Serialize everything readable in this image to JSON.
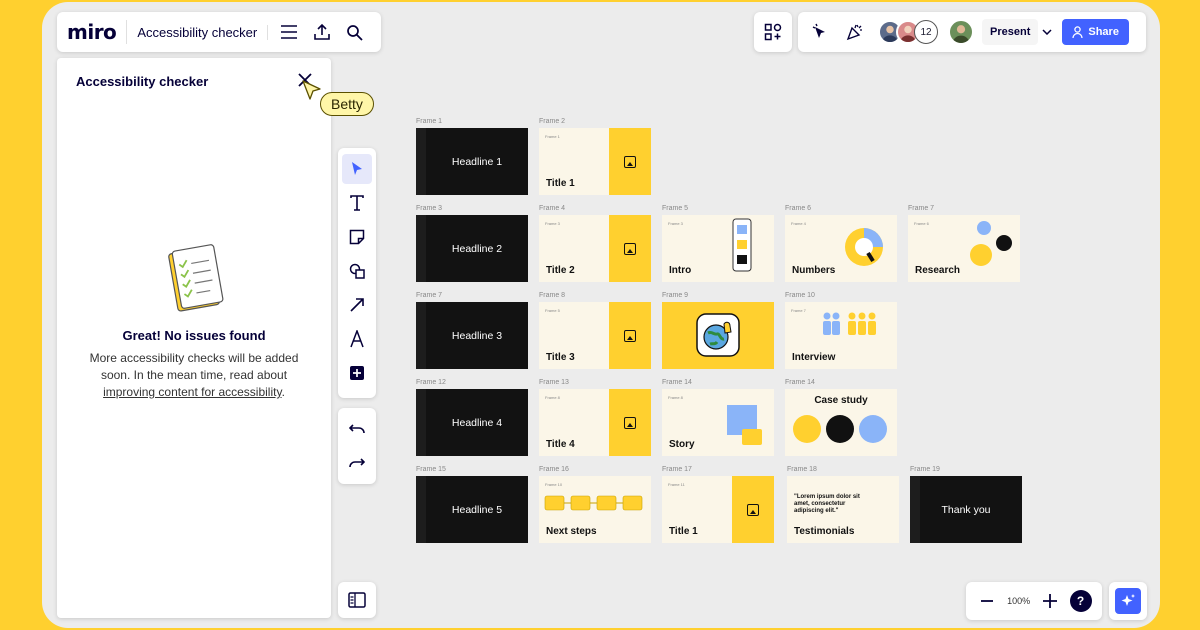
{
  "topbar": {
    "logo": "miro",
    "board_title": "Accessibility checker"
  },
  "side_panel": {
    "title": "Accessibility checker",
    "status_title": "Great! No issues found",
    "message": "More accessibility checks will be added soon. In the mean time, read about",
    "link_text": "improving content for accessibility",
    "period": "."
  },
  "cursor": {
    "name": "Betty"
  },
  "collab": {
    "collaborator_count": "12",
    "present_label": "Present",
    "share_label": "Share",
    "colors": {
      "accent": "#4262ff",
      "brand_yellow": "#FFD02F"
    }
  },
  "zoom": {
    "value": "100%"
  },
  "help": {
    "label": "?"
  },
  "frames": [
    {
      "label": "Frame 1",
      "style": "dark",
      "text": "Headline 1"
    },
    {
      "label": "Frame 2",
      "style": "title",
      "text": "Title 1",
      "mini": "Frame 1"
    },
    {
      "label": "Frame 3",
      "style": "dark",
      "text": "Headline 2"
    },
    {
      "label": "Frame 4",
      "style": "title",
      "text": "Title 2",
      "mini": "Frame 3"
    },
    {
      "label": "Frame 5",
      "style": "intro",
      "text": "Intro",
      "mini": "Frame 3"
    },
    {
      "label": "Frame 6",
      "style": "numbers",
      "text": "Numbers",
      "mini": "Frame 4"
    },
    {
      "label": "Frame 7",
      "style": "research",
      "text": "Research",
      "mini": "Frame 6"
    },
    {
      "label": "Frame 7",
      "style": "dark",
      "text": "Headline 3"
    },
    {
      "label": "Frame 8",
      "style": "title",
      "text": "Title 3",
      "mini": "Frame 5"
    },
    {
      "label": "Frame 9",
      "style": "emoji",
      "text": ""
    },
    {
      "label": "Frame 10",
      "style": "interview",
      "text": "Interview",
      "mini": "Frame 7"
    },
    {
      "label": "Frame 12",
      "style": "dark",
      "text": "Headline 4"
    },
    {
      "label": "Frame 13",
      "style": "title",
      "text": "Title 4",
      "mini": "Frame 8"
    },
    {
      "label": "Frame 14",
      "style": "story",
      "text": "Story",
      "mini": "Frame 8"
    },
    {
      "label": "Frame 14",
      "style": "case",
      "text": "Case study"
    },
    {
      "label": "Frame 15",
      "style": "dark",
      "text": "Headline 5"
    },
    {
      "label": "Frame 16",
      "style": "steps",
      "text": "Next steps",
      "mini": "Frame 10"
    },
    {
      "label": "Frame 17",
      "style": "title",
      "text": "Title 1",
      "mini": "Frame 11"
    },
    {
      "label": "Frame 18",
      "style": "quote",
      "text": "Testimonials",
      "quote": "\"Lorem ipsum dolor sit amet, consectetur adipiscing elit.\""
    },
    {
      "label": "Frame 19",
      "style": "thanks",
      "text": "Thank you"
    }
  ],
  "icons": [
    "menu-icon",
    "upload-icon",
    "search-icon",
    "close-icon",
    "cursor-icon",
    "select-icon",
    "text-icon",
    "sticky-note-icon",
    "shapes-icon",
    "arrow-icon",
    "pen-icon",
    "add-icon",
    "undo-icon",
    "redo-icon",
    "panel-icon",
    "zoom-out-icon",
    "zoom-in-icon",
    "sparkle-icon",
    "reactions-icon",
    "celebrate-icon",
    "apps-icon",
    "user-icon",
    "image-icon"
  ]
}
